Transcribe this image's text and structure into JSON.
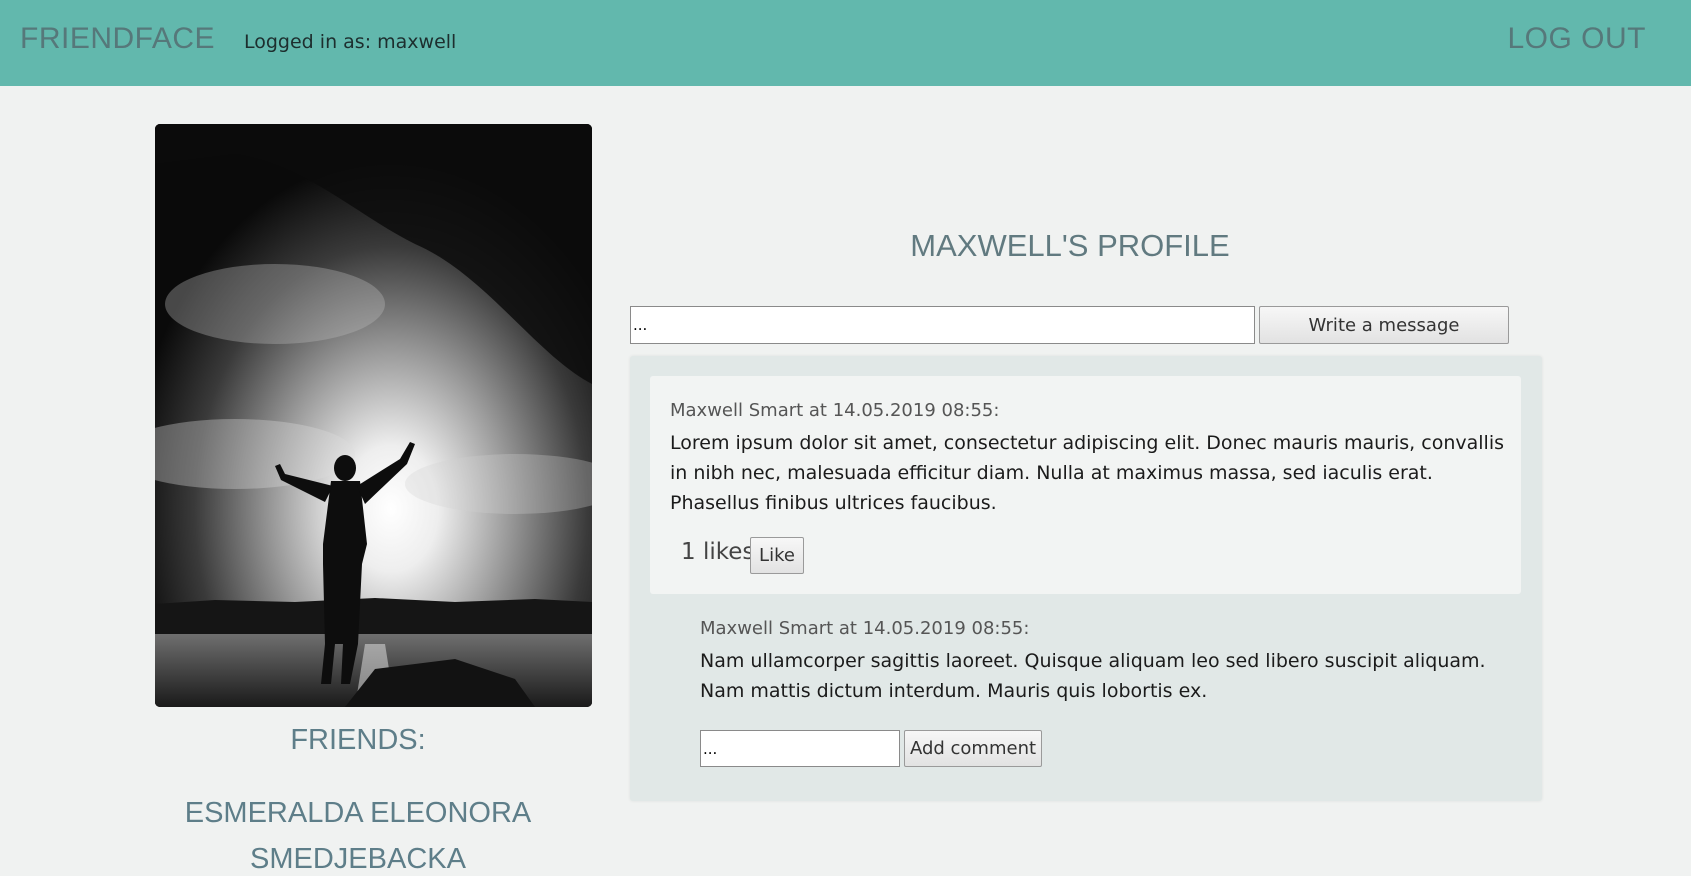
{
  "header": {
    "brand": "FRIENDFACE",
    "logged_in": "Logged in as: maxwell",
    "logout_label": "LOG OUT"
  },
  "profile": {
    "title": "MAXWELL'S PROFILE",
    "friends_title": "FRIENDS:",
    "friends": [
      "ESMERALDA ELEONORA SMEDJEBACKA"
    ]
  },
  "composer": {
    "value": "...",
    "button_label": "Write a message"
  },
  "posts": [
    {
      "meta": "Maxwell Smart at 14.05.2019 08:55:",
      "body": "Lorem ipsum dolor sit amet, consectetur adipiscing elit. Donec mauris mauris, convallis in nibh nec, malesuada efficitur diam. Nulla at maximus massa, sed iaculis erat. Phasellus finibus ultrices faucibus.",
      "likes": "1 likes",
      "like_label": "Like",
      "comments": [
        {
          "meta": "Maxwell Smart at 14.05.2019 08:55:",
          "body": "Nam ullamcorper sagittis laoreet. Quisque aliquam leo sed libero suscipit aliquam. Nam mattis dictum interdum. Mauris quis lobortis ex."
        }
      ],
      "comment_input_value": "...",
      "comment_button_label": "Add comment"
    }
  ],
  "colors": {
    "header_bg": "#62b8ad",
    "page_bg": "#f0f2f1",
    "feed_bg": "#e1e8e7",
    "post_bg": "#f2f4f3",
    "heading_text": "#5e7e89"
  }
}
